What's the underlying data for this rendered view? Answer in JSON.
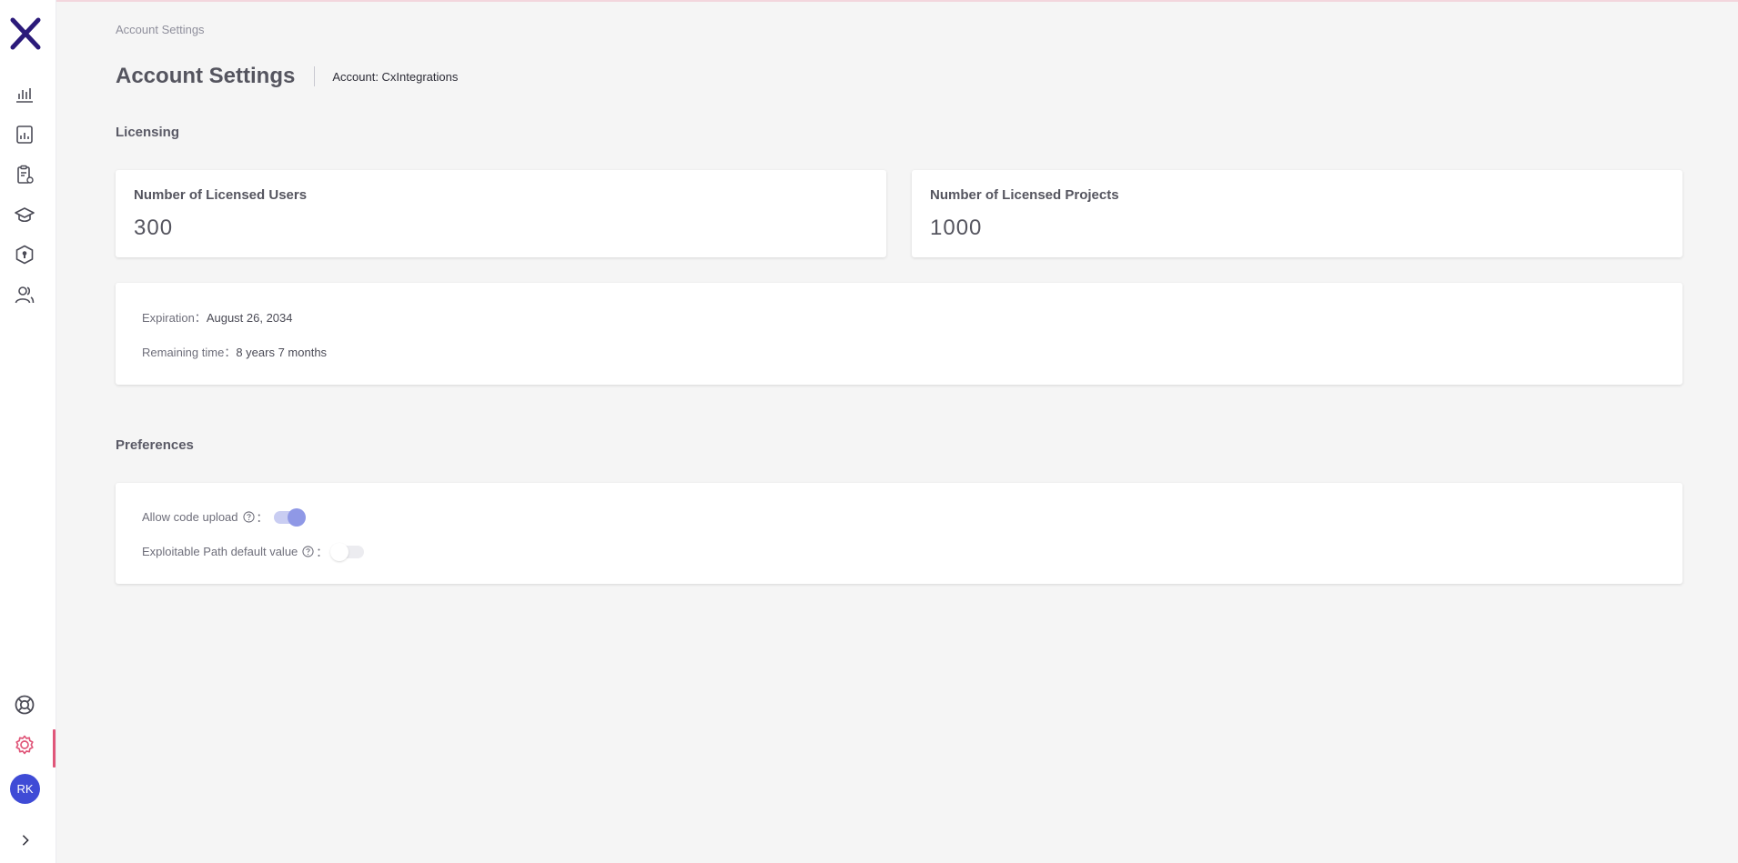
{
  "sidebar": {
    "logo": "checkmarx-x-logo",
    "nav_items": [
      {
        "icon": "bar-chart-icon",
        "name": "dashboard"
      },
      {
        "icon": "report-icon",
        "name": "reports"
      },
      {
        "icon": "clipboard-icon",
        "name": "policies"
      },
      {
        "icon": "graduation-cap-icon",
        "name": "learning"
      },
      {
        "icon": "shield-icon",
        "name": "security"
      },
      {
        "icon": "users-icon",
        "name": "users"
      }
    ],
    "bottom_items": [
      {
        "icon": "lifebuoy-icon",
        "name": "help"
      },
      {
        "icon": "gear-icon",
        "name": "settings",
        "active": true
      }
    ],
    "avatar_initials": "RK",
    "expand_icon": "chevron-right-icon"
  },
  "breadcrumb": "Account Settings",
  "header": {
    "title": "Account Settings",
    "account": "Account: CxIntegrations"
  },
  "licensing": {
    "section_title": "Licensing",
    "users_label": "Number of Licensed Users",
    "users_value": "300",
    "projects_label": "Number of Licensed Projects",
    "projects_value": "1000",
    "expiration_label": "Expiration：",
    "expiration_value": "August 26, 2034",
    "remaining_label": "Remaining time：",
    "remaining_value": "8 years 7 months"
  },
  "preferences": {
    "section_title": "Preferences",
    "code_upload_label": "Allow code upload",
    "code_upload_enabled": true,
    "exploitable_label": "Exploitable Path default value",
    "exploitable_enabled": false,
    "colon": "："
  },
  "colors": {
    "accent": "#e05679",
    "brand": "#2b1a7a",
    "avatar": "#3f4bd6",
    "toggle_on": "#8f98e6"
  }
}
